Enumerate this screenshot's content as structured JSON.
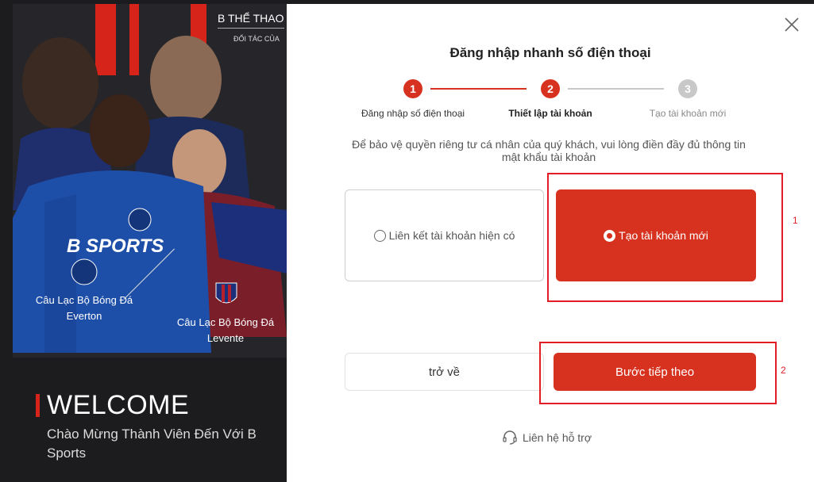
{
  "promo": {
    "brand_name": "B THỂ THAO",
    "brand_sub": "ĐỐI TÁC CỦA",
    "club_left": "Câu Lạc Bộ Bóng Đá Everton",
    "club_right": "Câu Lạc Bộ Bóng Đá Levente",
    "jersey_text": "B SPORTS",
    "welcome": "WELCOME",
    "welcome_sub": "Chào Mừng Thành Viên Đến Với B  Sports",
    "accent": "#d7241b"
  },
  "modal": {
    "title": "Đăng nhập nhanh số điện thoại",
    "steps": [
      {
        "num": "1",
        "label": "Đăng nhập số điện thoại",
        "state": "done"
      },
      {
        "num": "2",
        "label": "Thiết lập tài khoản",
        "state": "active"
      },
      {
        "num": "3",
        "label": "Tạo tài khoản mới",
        "state": "pending"
      }
    ],
    "description": "Để bảo vệ quyền riêng tư cá nhân của quý khách, vui lòng điền đầy đủ thông tin mật khẩu tài khoản",
    "option_link": "Liên kết tài khoản hiện có",
    "option_create": "Tạo tài khoản mới",
    "selected_option": "create",
    "back_button": "trở về",
    "next_button": "Bước tiếp theo",
    "support": "Liên hệ hỗ trợ",
    "annotation_1": "1",
    "annotation_2": "2",
    "primary_color": "#d7321f",
    "pending_color": "#c8c8c8"
  }
}
